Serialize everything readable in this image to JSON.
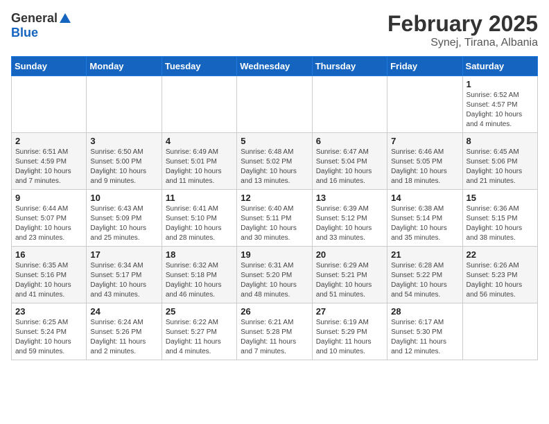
{
  "header": {
    "logo_general": "General",
    "logo_blue": "Blue",
    "month_year": "February 2025",
    "location": "Synej, Tirana, Albania"
  },
  "weekdays": [
    "Sunday",
    "Monday",
    "Tuesday",
    "Wednesday",
    "Thursday",
    "Friday",
    "Saturday"
  ],
  "weeks": [
    [
      {
        "day": "",
        "info": ""
      },
      {
        "day": "",
        "info": ""
      },
      {
        "day": "",
        "info": ""
      },
      {
        "day": "",
        "info": ""
      },
      {
        "day": "",
        "info": ""
      },
      {
        "day": "",
        "info": ""
      },
      {
        "day": "1",
        "info": "Sunrise: 6:52 AM\nSunset: 4:57 PM\nDaylight: 10 hours and 4 minutes."
      }
    ],
    [
      {
        "day": "2",
        "info": "Sunrise: 6:51 AM\nSunset: 4:59 PM\nDaylight: 10 hours and 7 minutes."
      },
      {
        "day": "3",
        "info": "Sunrise: 6:50 AM\nSunset: 5:00 PM\nDaylight: 10 hours and 9 minutes."
      },
      {
        "day": "4",
        "info": "Sunrise: 6:49 AM\nSunset: 5:01 PM\nDaylight: 10 hours and 11 minutes."
      },
      {
        "day": "5",
        "info": "Sunrise: 6:48 AM\nSunset: 5:02 PM\nDaylight: 10 hours and 13 minutes."
      },
      {
        "day": "6",
        "info": "Sunrise: 6:47 AM\nSunset: 5:04 PM\nDaylight: 10 hours and 16 minutes."
      },
      {
        "day": "7",
        "info": "Sunrise: 6:46 AM\nSunset: 5:05 PM\nDaylight: 10 hours and 18 minutes."
      },
      {
        "day": "8",
        "info": "Sunrise: 6:45 AM\nSunset: 5:06 PM\nDaylight: 10 hours and 21 minutes."
      }
    ],
    [
      {
        "day": "9",
        "info": "Sunrise: 6:44 AM\nSunset: 5:07 PM\nDaylight: 10 hours and 23 minutes."
      },
      {
        "day": "10",
        "info": "Sunrise: 6:43 AM\nSunset: 5:09 PM\nDaylight: 10 hours and 25 minutes."
      },
      {
        "day": "11",
        "info": "Sunrise: 6:41 AM\nSunset: 5:10 PM\nDaylight: 10 hours and 28 minutes."
      },
      {
        "day": "12",
        "info": "Sunrise: 6:40 AM\nSunset: 5:11 PM\nDaylight: 10 hours and 30 minutes."
      },
      {
        "day": "13",
        "info": "Sunrise: 6:39 AM\nSunset: 5:12 PM\nDaylight: 10 hours and 33 minutes."
      },
      {
        "day": "14",
        "info": "Sunrise: 6:38 AM\nSunset: 5:14 PM\nDaylight: 10 hours and 35 minutes."
      },
      {
        "day": "15",
        "info": "Sunrise: 6:36 AM\nSunset: 5:15 PM\nDaylight: 10 hours and 38 minutes."
      }
    ],
    [
      {
        "day": "16",
        "info": "Sunrise: 6:35 AM\nSunset: 5:16 PM\nDaylight: 10 hours and 41 minutes."
      },
      {
        "day": "17",
        "info": "Sunrise: 6:34 AM\nSunset: 5:17 PM\nDaylight: 10 hours and 43 minutes."
      },
      {
        "day": "18",
        "info": "Sunrise: 6:32 AM\nSunset: 5:18 PM\nDaylight: 10 hours and 46 minutes."
      },
      {
        "day": "19",
        "info": "Sunrise: 6:31 AM\nSunset: 5:20 PM\nDaylight: 10 hours and 48 minutes."
      },
      {
        "day": "20",
        "info": "Sunrise: 6:29 AM\nSunset: 5:21 PM\nDaylight: 10 hours and 51 minutes."
      },
      {
        "day": "21",
        "info": "Sunrise: 6:28 AM\nSunset: 5:22 PM\nDaylight: 10 hours and 54 minutes."
      },
      {
        "day": "22",
        "info": "Sunrise: 6:26 AM\nSunset: 5:23 PM\nDaylight: 10 hours and 56 minutes."
      }
    ],
    [
      {
        "day": "23",
        "info": "Sunrise: 6:25 AM\nSunset: 5:24 PM\nDaylight: 10 hours and 59 minutes."
      },
      {
        "day": "24",
        "info": "Sunrise: 6:24 AM\nSunset: 5:26 PM\nDaylight: 11 hours and 2 minutes."
      },
      {
        "day": "25",
        "info": "Sunrise: 6:22 AM\nSunset: 5:27 PM\nDaylight: 11 hours and 4 minutes."
      },
      {
        "day": "26",
        "info": "Sunrise: 6:21 AM\nSunset: 5:28 PM\nDaylight: 11 hours and 7 minutes."
      },
      {
        "day": "27",
        "info": "Sunrise: 6:19 AM\nSunset: 5:29 PM\nDaylight: 11 hours and 10 minutes."
      },
      {
        "day": "28",
        "info": "Sunrise: 6:17 AM\nSunset: 5:30 PM\nDaylight: 11 hours and 12 minutes."
      },
      {
        "day": "",
        "info": ""
      }
    ]
  ]
}
